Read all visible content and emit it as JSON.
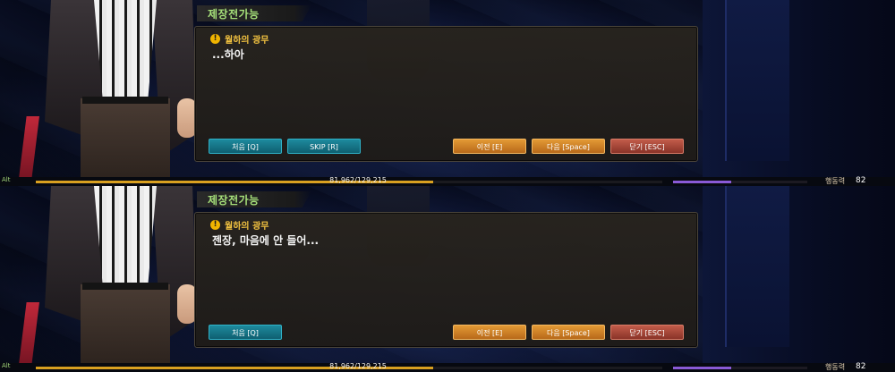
{
  "panels": [
    {
      "tag": "제장전가능",
      "speaker": "월하의 광무",
      "dialog_text": "...하아",
      "buttons": {
        "first": "처음 [Q]",
        "skip": "SKIP [R]",
        "prev": "이전 [E]",
        "next": "다음 [Space]",
        "close": "닫기 [ESC]"
      },
      "statusbar": {
        "hotkey_label": "Alt",
        "exp_text": "81,962/129,215",
        "exp_fraction": 0.634,
        "purple_fraction": 0.43,
        "action_points_label": "행동력",
        "action_points_value": "82"
      }
    },
    {
      "tag": "제장전가능",
      "speaker": "월하의 광무",
      "dialog_text": "젠장, 마음에 안 들어...",
      "buttons": {
        "first": "처음 [Q]",
        "prev": "이전 [E]",
        "next": "다음 [Space]",
        "close": "닫기 [ESC]"
      },
      "statusbar": {
        "hotkey_label": "Alt",
        "exp_text": "81,962/129,215",
        "exp_fraction": 0.634,
        "purple_fraction": 0.43,
        "action_points_label": "행동력",
        "action_points_value": "82"
      }
    }
  ],
  "colors": {
    "tag_text": "#a6e07a",
    "speaker_name": "#f2c240",
    "warning_icon": "#f0b400",
    "teal_button": "#1d8a9e",
    "orange_button": "#e39a35",
    "red_button": "#c25c4a",
    "exp_bar": "#d9a020",
    "purple_bar": "#8a5ad6"
  },
  "icons": {
    "speaker_icon": "warning-circle-icon"
  }
}
